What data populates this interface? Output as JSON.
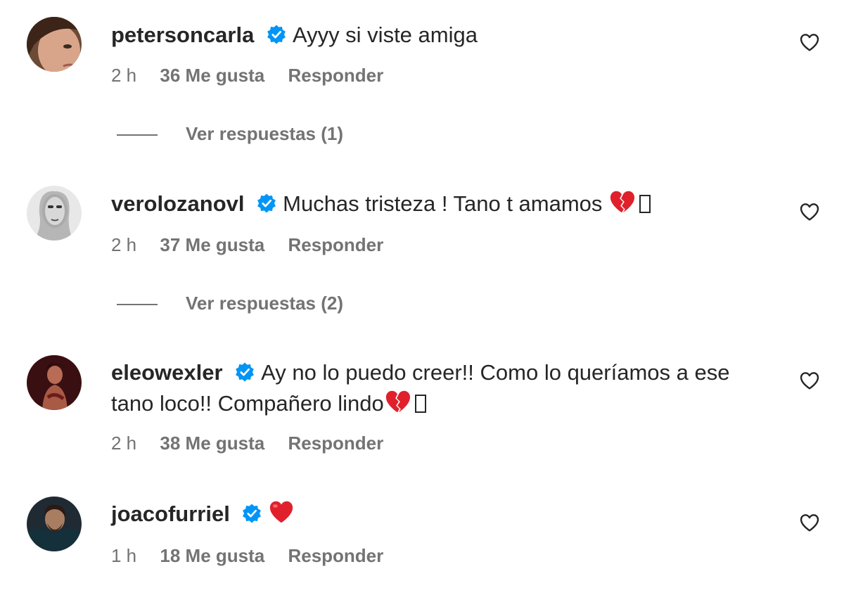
{
  "comments": [
    {
      "username": "petersoncarla",
      "text": "Ayyy si viste amiga",
      "emoji": "",
      "time": "2 h",
      "likes": "36 Me gusta",
      "reply": "Responder",
      "view_replies": "Ver respuestas (1)"
    },
    {
      "username": "verolozanovl",
      "text": "Muchas tristeza ! Tano t amamos ",
      "emoji": "broken-heart",
      "time": "2 h",
      "likes": "37 Me gusta",
      "reply": "Responder",
      "view_replies": "Ver respuestas (2)"
    },
    {
      "username": "eleowexler",
      "text": "Ay no lo puedo creer!! Como lo queríamos a ese tano loco!! Compañero lindo",
      "emoji": "broken-heart",
      "time": "2 h",
      "likes": "38 Me gusta",
      "reply": "Responder"
    },
    {
      "username": "joacofurriel",
      "text": "",
      "emoji": "red-heart",
      "time": "1 h",
      "likes": "18 Me gusta",
      "reply": "Responder"
    }
  ],
  "colors": {
    "verified": "#0095f6",
    "heart_emoji": "#e0212b",
    "secondary_text": "#737373"
  }
}
